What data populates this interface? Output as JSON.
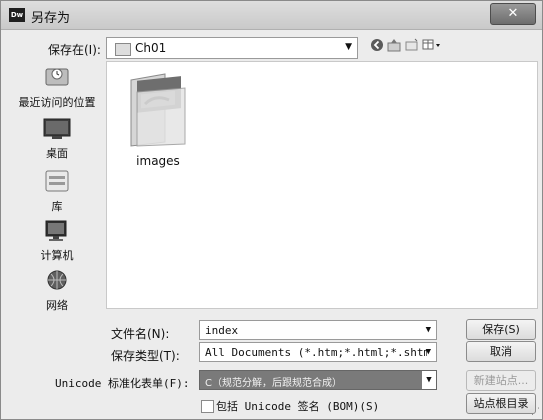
{
  "window": {
    "app_icon_text": "Dw",
    "title": "另存为",
    "close_symbol": "✕"
  },
  "toolbar": {
    "save_in_label": "保存在(I):",
    "save_in_value": "Ch01",
    "icons": [
      "back-icon",
      "up-folder-icon",
      "new-folder-icon",
      "view-menu-icon"
    ]
  },
  "places": [
    {
      "label": "最近访问的位置",
      "icon": "recent-places-icon"
    },
    {
      "label": "桌面",
      "icon": "desktop-icon"
    },
    {
      "label": "库",
      "icon": "libraries-icon"
    },
    {
      "label": "计算机",
      "icon": "computer-icon"
    },
    {
      "label": "网络",
      "icon": "network-icon"
    }
  ],
  "files": [
    {
      "name": "images",
      "icon": "folder-icon"
    }
  ],
  "form": {
    "filename_label": "文件名(N):",
    "filename_value": "index",
    "filetype_label": "保存类型(T):",
    "filetype_value": "All Documents (*.htm;*.html;*.shtm;*.s",
    "unicode_label": "Unicode 标准化表单(F):",
    "unicode_value": "C（规范分解，后跟规范合成）",
    "bom_label": "包括 Unicode 签名 (BOM)(S)"
  },
  "buttons": {
    "save": "保存(S)",
    "cancel": "取消",
    "new_site": "新建站点...",
    "site_root": "站点根目录"
  },
  "colors": {
    "dialog_bg": "#ececec",
    "file_area_bg": "#ffffff",
    "highlight_selected": "#7a7a7a"
  }
}
